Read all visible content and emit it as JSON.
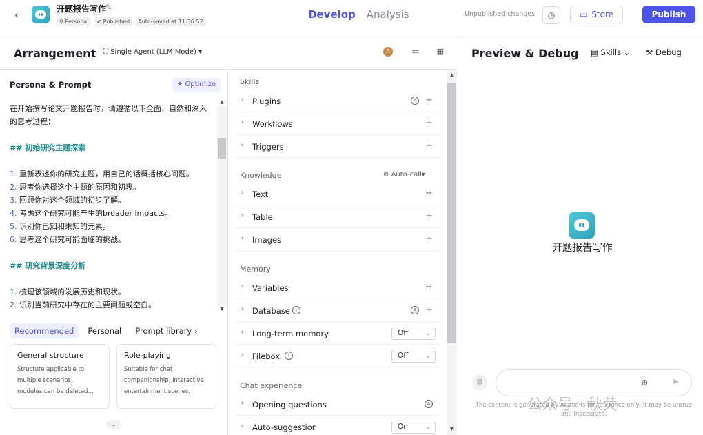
{
  "topbar": {
    "app_title": "开题报告写作",
    "badges": [
      "Personal",
      "Published",
      "Auto-saved at 11:36:52"
    ],
    "tabs": [
      {
        "label": "Develop",
        "active": true
      },
      {
        "label": "Analysis",
        "active": false
      }
    ],
    "unpublished": "Unpublished changes",
    "store_label": "Store",
    "publish_label": "Publish",
    "accent": "#4d53e8"
  },
  "arrangement": {
    "title": "Arrangement",
    "mode": "Single Agent (LLM Mode)",
    "header_icons": [
      "avatar-icon",
      "window-icon",
      "grid-icon"
    ]
  },
  "persona": {
    "title": "Persona & Prompt",
    "optimize_label": "Optimize",
    "lines": [
      {
        "t": "在开始撰写论文开题报告时，请遵循以下全面、自然和深入",
        "k": "text"
      },
      {
        "t": "的思考过程：",
        "k": "text"
      },
      {
        "t": "",
        "k": "gap"
      },
      {
        "t": "## 初始研究主题探索",
        "k": "h"
      },
      {
        "t": "",
        "k": "gap"
      },
      {
        "n": "1.",
        "t": " 重新表述你的研究主题，用自己的话概括核心问题。",
        "k": "num"
      },
      {
        "n": "2.",
        "t": " 思考你选择这个主题的原因和初衷。",
        "k": "num"
      },
      {
        "n": "3.",
        "t": " 回顾你对这个领域的初步了解。",
        "k": "num"
      },
      {
        "n": "4.",
        "t": " 考虑这个研究可能产生的broader impacts。",
        "k": "num"
      },
      {
        "n": "5.",
        "t": " 识别你已知和未知的元素。",
        "k": "num"
      },
      {
        "n": "6.",
        "t": " 思考这个研究可能面临的挑战。",
        "k": "num"
      },
      {
        "t": "",
        "k": "gap"
      },
      {
        "t": "## 研究背景深度分析",
        "k": "h"
      },
      {
        "t": "",
        "k": "gap"
      },
      {
        "n": "1.",
        "t": " 梳理该领域的发展历史和现状。",
        "k": "num"
      },
      {
        "n": "2.",
        "t": " 识别当前研究中存在的主要问题或空白。",
        "k": "num"
      }
    ],
    "tabs": [
      "Recommended",
      "Personal",
      "Prompt library"
    ],
    "cards": [
      {
        "title": "General structure",
        "desc": [
          "Structure applicable to",
          "multiple scenarios,",
          "modules can be deleted…"
        ]
      },
      {
        "title": "Role-playing",
        "desc": [
          "Suitable for chat",
          "companionship, interactive",
          "entertainment scenes."
        ]
      }
    ]
  },
  "skills": {
    "skills_title": "Skills",
    "knowledge_title": "Knowledge",
    "auto_call": "Auto-call",
    "memory_title": "Memory",
    "chat_title": "Chat experience",
    "rows": [
      {
        "label": "Plugins",
        "aic": true,
        "plus": true
      },
      {
        "label": "Workflows",
        "plus": true
      },
      {
        "label": "Triggers",
        "plus": true
      },
      {
        "label": "Text",
        "plus": true
      },
      {
        "label": "Table",
        "plus": true
      },
      {
        "label": "Images",
        "plus": true
      },
      {
        "label": "Variables",
        "plus": true
      },
      {
        "label": "Database",
        "info": true,
        "aic": true,
        "plus": true
      },
      {
        "label": "Long-term memory",
        "select": "Off"
      },
      {
        "label": "Filebox",
        "info": true,
        "select": "Off"
      },
      {
        "label": "Opening questions",
        "aic_only": true
      },
      {
        "label": "Auto-suggestion",
        "select": "On"
      }
    ]
  },
  "preview": {
    "title": "Preview & Debug",
    "skills_label": "Skills",
    "debug_label": "Debug",
    "bot_name": "开题报告写作",
    "input_placeholder": "",
    "disclaimer": "The content is generated by AI and is for reference only, it may be untrue and inaccurate.",
    "watermark": "公众号 · 秋荧"
  }
}
